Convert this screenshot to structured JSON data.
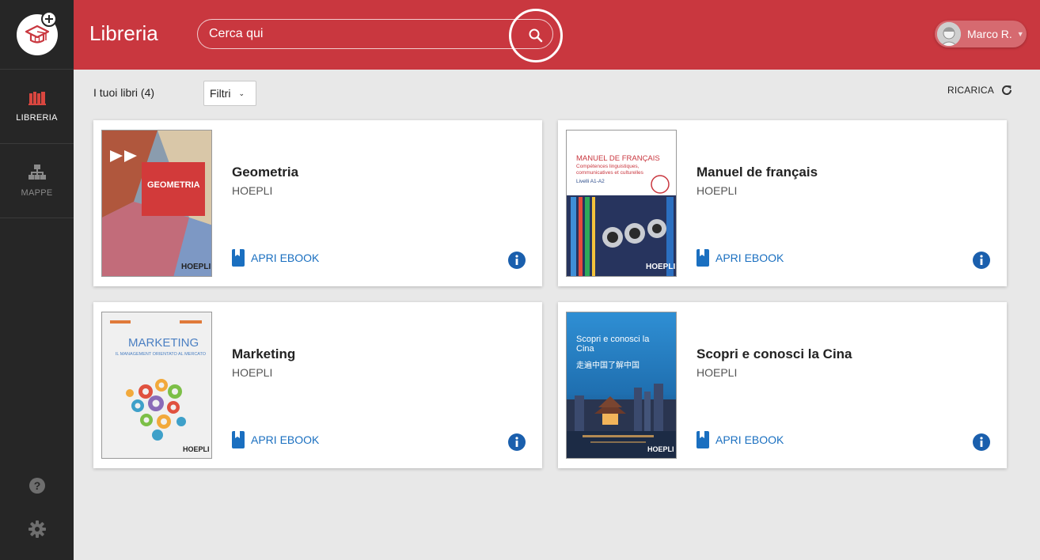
{
  "sidebar": {
    "items": [
      {
        "label": "LIBRERIA"
      },
      {
        "label": "MAPPE"
      }
    ]
  },
  "header": {
    "title": "Libreria",
    "search_placeholder": "Cerca qui",
    "user_name": "Marco R."
  },
  "toolbar": {
    "count_label": "I tuoi libri (4)",
    "filter_label": "Filtri",
    "reload_label": "RICARICA"
  },
  "books": [
    {
      "title": "Geometria",
      "publisher": "HOEPLI",
      "action": "APRI EBOOK",
      "cover": {
        "label": "GEOMETRIA",
        "brand": "HOEPLI",
        "color": "#c9373f"
      }
    },
    {
      "title": "Manuel de français",
      "publisher": "HOEPLI",
      "action": "APRI EBOOK",
      "cover": {
        "label": "MANUEL DE FRANÇAIS",
        "sub": "Compétences linguistiques, communicatives et culturelles",
        "level": "Livelli A1-A2",
        "brand": "HOEPLI",
        "color": "#c9373f"
      }
    },
    {
      "title": "Marketing",
      "publisher": "HOEPLI",
      "action": "APRI EBOOK",
      "cover": {
        "label": "MARKETING",
        "sub": "IL MANAGEMENT ORIENTATO AL MERCATO",
        "brand": "HOEPLI",
        "color": "#4a7fc2"
      }
    },
    {
      "title": "Scopri e conosci la Cina",
      "publisher": "HOEPLI",
      "action": "APRI EBOOK",
      "cover": {
        "label": "Scopri e conosci la Cina",
        "chinese": "走遍中国了解中国",
        "brand": "HOEPLI",
        "color": "#2b86cc"
      }
    }
  ],
  "colors": {
    "brand_red": "#c9373f",
    "sidebar_bg": "#262626",
    "link_blue": "#1a6fc0",
    "info_blue": "#1a5fad"
  }
}
